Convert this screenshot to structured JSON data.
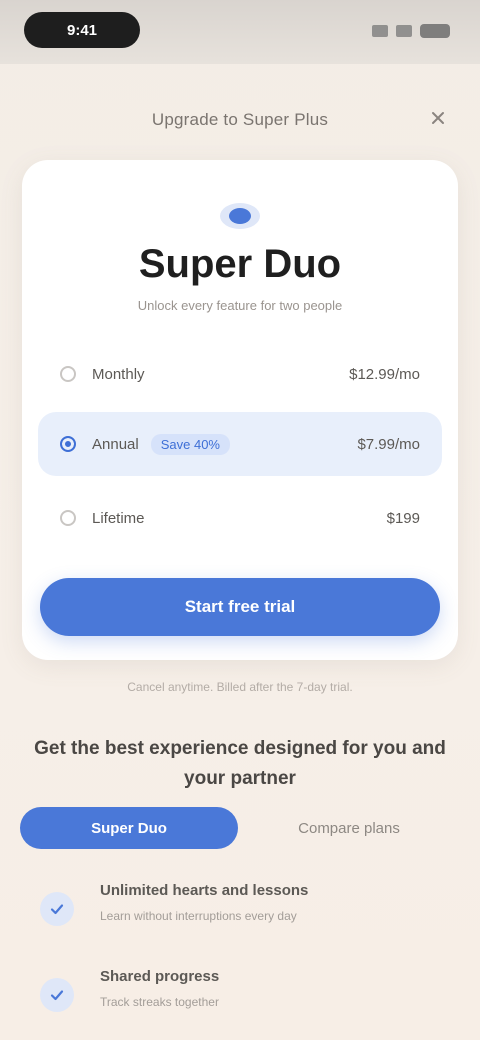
{
  "status_bar": {
    "time": "9:41"
  },
  "sheet": {
    "title": "Upgrade to Super Plus",
    "close_icon": "close-icon"
  },
  "plan": {
    "badge_icon": "sparkle-badge-icon",
    "name": "Super Duo",
    "subtitle": "Unlock every feature for two people",
    "options": [
      {
        "label": "Monthly",
        "price": "$12.99/mo",
        "selected": false
      },
      {
        "label": "Annual",
        "save_badge": "Save 40%",
        "price": "$7.99/mo",
        "selected": true
      },
      {
        "label": "Lifetime",
        "price": "$199",
        "selected": false
      }
    ],
    "cta_label": "Start free trial"
  },
  "fine_print": "Cancel anytime. Billed after the 7-day trial.",
  "features": {
    "title": "Get the best experience designed for you and your partner",
    "tabs": [
      {
        "label": "Super Duo",
        "active": true
      },
      {
        "label": "Compare plans",
        "active": false
      }
    ],
    "items": [
      {
        "icon": "check-icon",
        "title": "Unlimited hearts and lessons",
        "desc": "Learn without interruptions every day"
      },
      {
        "icon": "check-icon",
        "title": "Shared progress",
        "desc": "Track streaks together"
      }
    ]
  },
  "colors": {
    "accent": "#4a78d8",
    "accent_soft": "#e8effb",
    "background": "#f6efe8"
  }
}
